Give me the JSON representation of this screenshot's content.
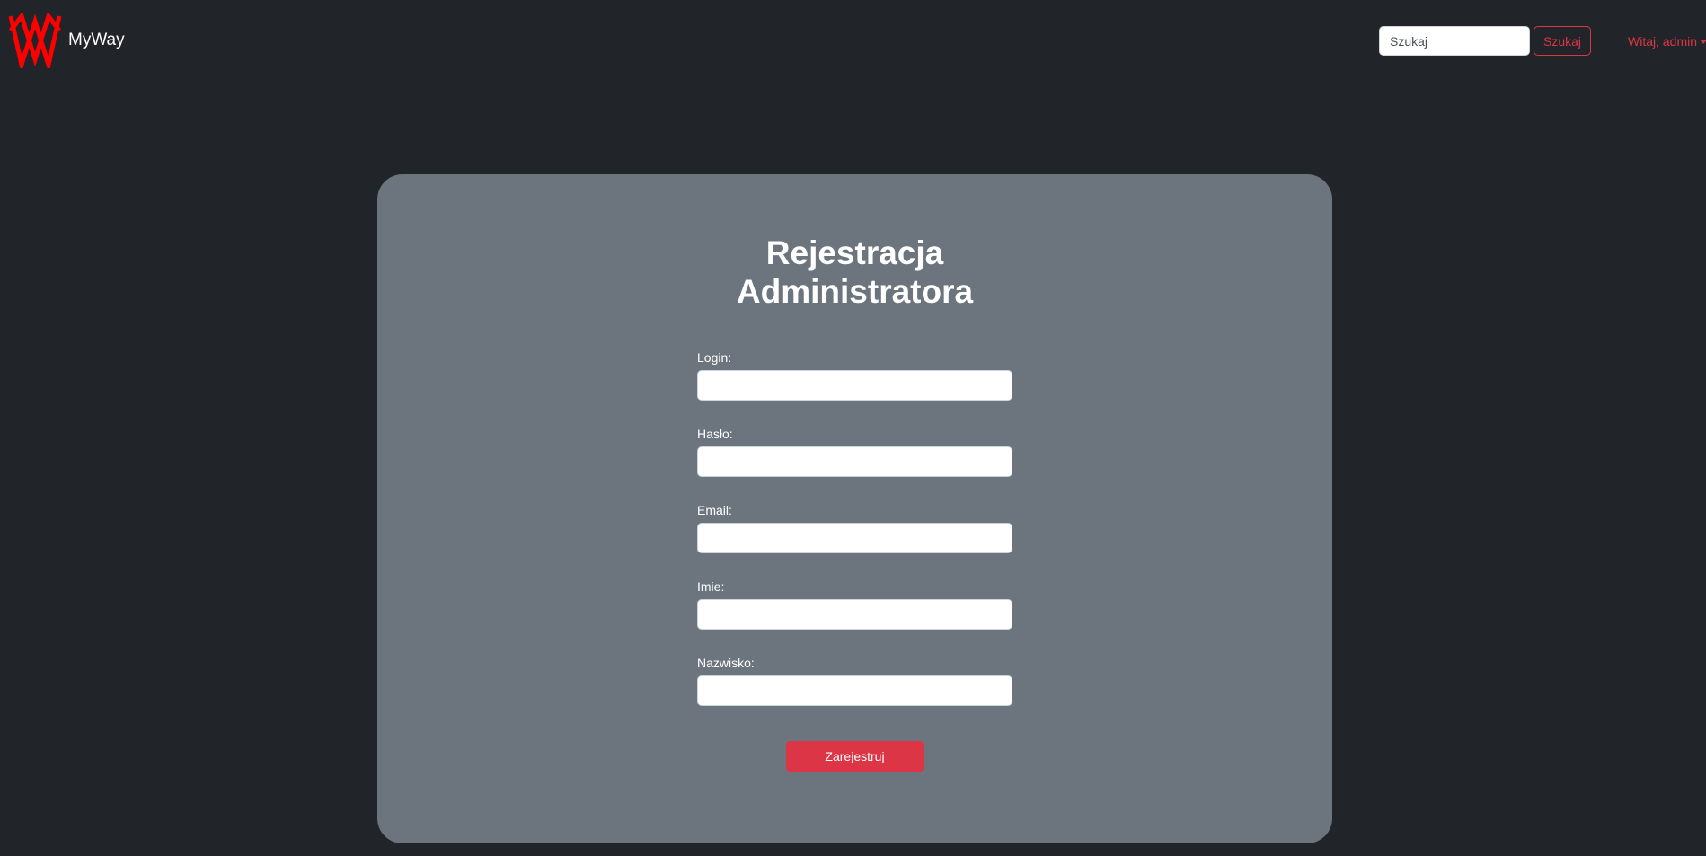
{
  "navbar": {
    "brand_name": "MyWay",
    "logo_icon": "myway-logo-icon",
    "search": {
      "placeholder": "Szukaj",
      "value": "",
      "button_label": "Szukaj"
    },
    "user_menu_label": "Witaj, admin",
    "user_menu_icon": "caret-down-icon"
  },
  "form": {
    "title_line1": "Rejestracja",
    "title_line2": "Administratora",
    "fields": [
      {
        "label": "Login:",
        "value": ""
      },
      {
        "label": "Hasło:",
        "value": ""
      },
      {
        "label": "Email:",
        "value": ""
      },
      {
        "label": "Imie:",
        "value": ""
      },
      {
        "label": "Nazwisko:",
        "value": ""
      }
    ],
    "submit_label": "Zarejestruj"
  },
  "colors": {
    "background": "#212529",
    "card": "#6c757d",
    "accent": "#dc3545",
    "logo": "#ff0000"
  }
}
